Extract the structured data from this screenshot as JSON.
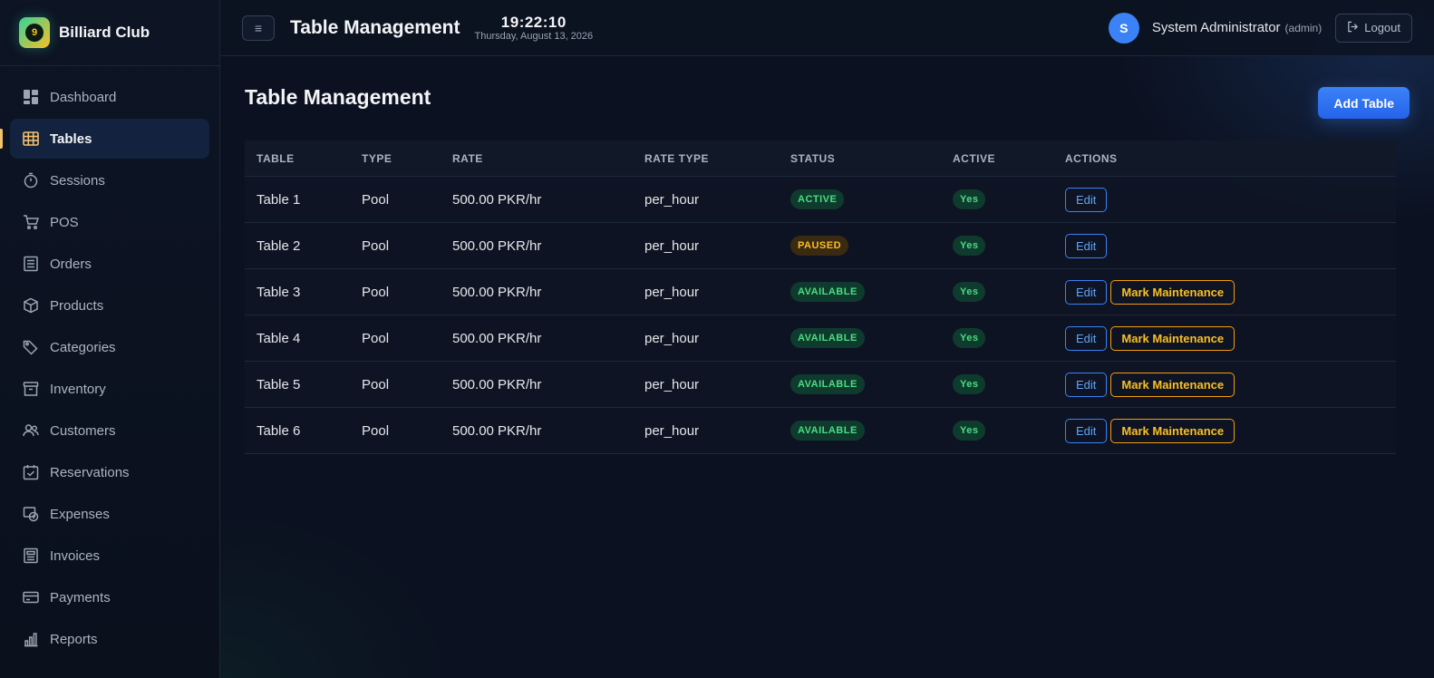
{
  "brand": {
    "name": "Billiard Club",
    "logo_glyph": "9"
  },
  "sidebar": {
    "items": [
      {
        "label": "Dashboard",
        "icon": "dashboard-icon",
        "active": false
      },
      {
        "label": "Tables",
        "icon": "table-grid-icon",
        "active": true
      },
      {
        "label": "Sessions",
        "icon": "stopwatch-icon",
        "active": false
      },
      {
        "label": "POS",
        "icon": "cart-icon",
        "active": false
      },
      {
        "label": "Orders",
        "icon": "receipt-icon",
        "active": false
      },
      {
        "label": "Products",
        "icon": "box-icon",
        "active": false
      },
      {
        "label": "Categories",
        "icon": "tag-icon",
        "active": false
      },
      {
        "label": "Inventory",
        "icon": "archive-icon",
        "active": false
      },
      {
        "label": "Customers",
        "icon": "users-icon",
        "active": false
      },
      {
        "label": "Reservations",
        "icon": "calendar-check-icon",
        "active": false
      },
      {
        "label": "Expenses",
        "icon": "expense-icon",
        "active": false
      },
      {
        "label": "Invoices",
        "icon": "invoice-icon",
        "active": false
      },
      {
        "label": "Payments",
        "icon": "card-icon",
        "active": false
      },
      {
        "label": "Reports",
        "icon": "bar-chart-icon",
        "active": false
      }
    ]
  },
  "topbar": {
    "menu_glyph": "≡",
    "title": "Table Management",
    "time": "19:22:10",
    "date": "Thursday, August 13, 2026",
    "user_initial": "S",
    "user_name": "System Administrator",
    "user_role": "(admin)",
    "logout_label": "Logout"
  },
  "page": {
    "title": "Table Management",
    "add_button": "Add Table"
  },
  "table": {
    "headers": {
      "table": "TABLE",
      "type": "TYPE",
      "rate": "RATE",
      "rate_type": "RATE TYPE",
      "status": "STATUS",
      "active": "ACTIVE",
      "actions": "ACTIONS"
    },
    "rows": [
      {
        "name": "Table 1",
        "type": "Pool",
        "rate": "500.00 PKR/hr",
        "rate_type": "per_hour",
        "status": "ACTIVE",
        "status_tone": "green",
        "active": "Yes",
        "actions": [
          "Edit"
        ]
      },
      {
        "name": "Table 2",
        "type": "Pool",
        "rate": "500.00 PKR/hr",
        "rate_type": "per_hour",
        "status": "PAUSED",
        "status_tone": "amber",
        "active": "Yes",
        "actions": [
          "Edit"
        ]
      },
      {
        "name": "Table 3",
        "type": "Pool",
        "rate": "500.00 PKR/hr",
        "rate_type": "per_hour",
        "status": "AVAILABLE",
        "status_tone": "green",
        "active": "Yes",
        "actions": [
          "Edit",
          "Mark Maintenance"
        ]
      },
      {
        "name": "Table 4",
        "type": "Pool",
        "rate": "500.00 PKR/hr",
        "rate_type": "per_hour",
        "status": "AVAILABLE",
        "status_tone": "green",
        "active": "Yes",
        "actions": [
          "Edit",
          "Mark Maintenance"
        ]
      },
      {
        "name": "Table 5",
        "type": "Pool",
        "rate": "500.00 PKR/hr",
        "rate_type": "per_hour",
        "status": "AVAILABLE",
        "status_tone": "green",
        "active": "Yes",
        "actions": [
          "Edit",
          "Mark Maintenance"
        ]
      },
      {
        "name": "Table 6",
        "type": "Pool",
        "rate": "500.00 PKR/hr",
        "rate_type": "per_hour",
        "status": "AVAILABLE",
        "status_tone": "green",
        "active": "Yes",
        "actions": [
          "Edit",
          "Mark Maintenance"
        ]
      }
    ]
  },
  "colors": {
    "accent": "#3b82f6",
    "active_nav_marker": "#f5c26b",
    "status_green": "#4ade80",
    "status_amber": "#fbbf24",
    "background": "#0b1120"
  }
}
